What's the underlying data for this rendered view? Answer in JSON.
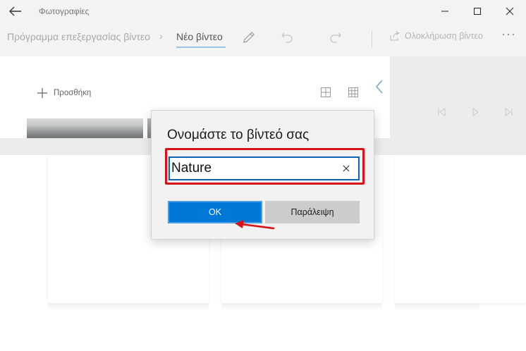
{
  "titlebar": {
    "app_title": "Φωτογραφίες",
    "back_icon": "arrow-left-icon",
    "controls": [
      "minimize-icon",
      "maximize-icon",
      "close-icon"
    ]
  },
  "toolbar": {
    "breadcrumb_parent": "Πρόγραμμα επεξεργασίας βίντεο",
    "breadcrumb_separator": "›",
    "breadcrumb_current": "Νέο βίντεο",
    "rename_icon": "pencil-icon",
    "undo_icon": "undo-icon",
    "redo_icon": "redo-icon",
    "finish_label": "Ολοκλήρωση βίντεο",
    "finish_icon": "share-icon",
    "more_label": "···"
  },
  "library": {
    "add_label": "Προσθήκη",
    "add_icon": "plus-icon",
    "view_icons": [
      "grid-large-icon",
      "grid-small-icon"
    ],
    "collapse_icon": "chevron-left-icon"
  },
  "player": {
    "controls": [
      "previous-frame-icon",
      "play-icon",
      "next-frame-icon"
    ]
  },
  "dialog": {
    "title": "Ονομάστε το βίντεό σας",
    "input_value": "Nature",
    "clear_icon": "close-icon",
    "ok_label": "OK",
    "skip_label": "Παράλειψη"
  },
  "colors": {
    "accent": "#0078d7",
    "highlight_annotation": "#d9111a",
    "chrome_background": "#f3f3f3"
  }
}
